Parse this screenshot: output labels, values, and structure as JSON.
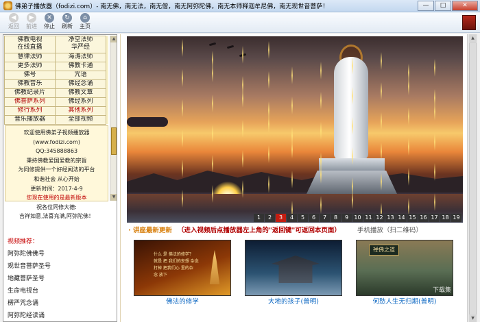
{
  "window": {
    "title": "佛弟子播放器（fodizi.com）- 南无佛，南无法，南无僧，南无阿弥陀佛，南无本师释迦牟尼佛，南无观世音菩萨！",
    "min": "—",
    "max": "□",
    "close": "✕"
  },
  "toolbar": {
    "back": "返回",
    "forward": "前进",
    "stop": "停止",
    "refresh": "刷新",
    "home": "主页"
  },
  "nav": [
    [
      "佛教电视\n在线直播",
      "净空法师\n华严经"
    ],
    [
      "慧律法师",
      "海涛法师"
    ],
    [
      "更多法师",
      "佛教卡通"
    ],
    [
      "佛号",
      "咒语"
    ],
    [
      "佛教音乐",
      "佛经念诵"
    ],
    [
      "佛教纪录片",
      "佛教文章"
    ],
    [
      "佛菩萨系列",
      "佛经系列"
    ],
    [
      "修行系列",
      "其他系列"
    ],
    [
      "音乐播放器",
      "全部视频"
    ]
  ],
  "info": [
    "欢迎使用佛弟子视频播放器",
    "(www.fodizi.com)",
    "QQ:345888863",
    "秉持佛教爱国爱教的宗旨",
    "为同修提供一个好经闻法的平台",
    "和谐社会 从心开始",
    "更新时间：2017-4-9",
    "您现在使用的是最新版本",
    "祝各位同修大德:",
    "吉祥如意,法喜充满,阿弥陀佛！"
  ],
  "video_list": {
    "header": "视频推荐：",
    "items": [
      "阿弥陀佛佛号",
      "观世音菩萨圣号",
      "地藏菩萨圣号",
      "生命电视台",
      "楞严咒念诵",
      "阿弥陀经读诵"
    ]
  },
  "banner": {
    "pages": [
      "1",
      "2",
      "3",
      "4",
      "5",
      "6",
      "7",
      "8",
      "9",
      "10",
      "11",
      "12",
      "13",
      "14",
      "15",
      "16",
      "17",
      "18",
      "19"
    ],
    "current_page": 3
  },
  "notice": {
    "prefix": "· 讲座最新更新",
    "highlight": "（进入视频后点播放器左上角的\"返回键\"可返回本页面）",
    "mobile": "手机播放（扫二维码）"
  },
  "thumbs": [
    {
      "caption": "佛法的修学",
      "lines": [
        "什么 是 佛法的修学？",
        "就是 把 我们的妄想 杂念",
        "打掉 把我们心 里的杂",
        "念 放下"
      ]
    },
    {
      "caption": "大地的孩子(普明)"
    },
    {
      "caption": "何愁人生无归期(普明)",
      "sign": "禅佛之道",
      "watermark": "下载集"
    }
  ]
}
